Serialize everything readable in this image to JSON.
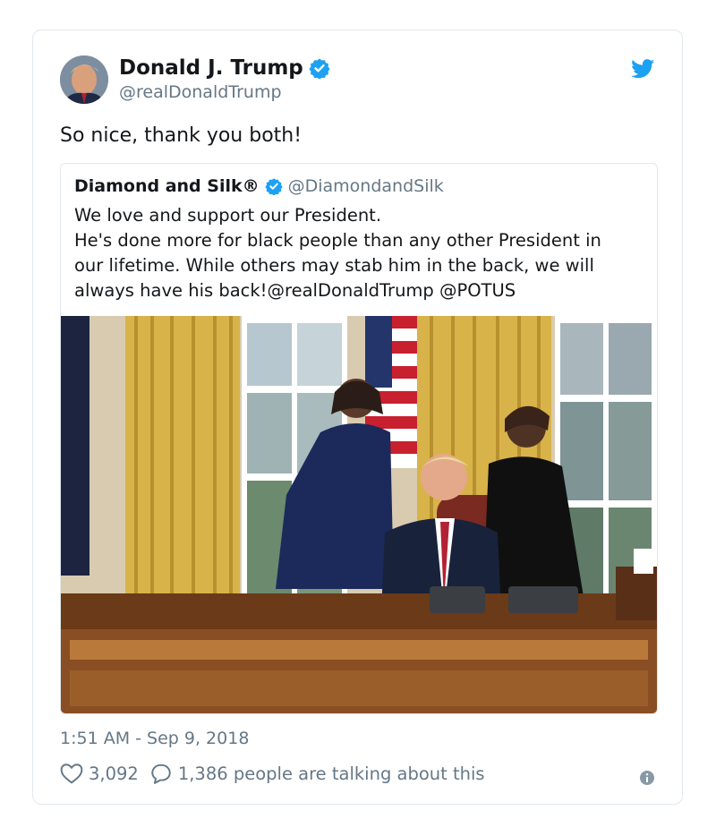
{
  "author": {
    "name": "Donald J. Trump",
    "handle": "@realDonaldTrump",
    "avatar_icon": "profile-photo",
    "verified": true
  },
  "tweet": {
    "text": "So nice, thank you both!",
    "timestamp": "1:51 AM - Sep 9, 2018"
  },
  "quoted_tweet": {
    "name": "Diamond and Silk®",
    "handle": "@DiamondandSilk",
    "verified": true,
    "lines": [
      "We love and support our President.",
      "He's done more for black people than any other President in",
      "our lifetime. While others may stab him in the back, we will",
      "always have his back!@realDonaldTrump @POTUS"
    ],
    "photo_icon": "oval-office-photo"
  },
  "stats": {
    "likes": "3,092",
    "talking": "1,386 people are talking about this"
  },
  "colors": {
    "brand_blue": "#1da1f2",
    "secondary_text": "#657786",
    "border": "#e1e8ed"
  }
}
